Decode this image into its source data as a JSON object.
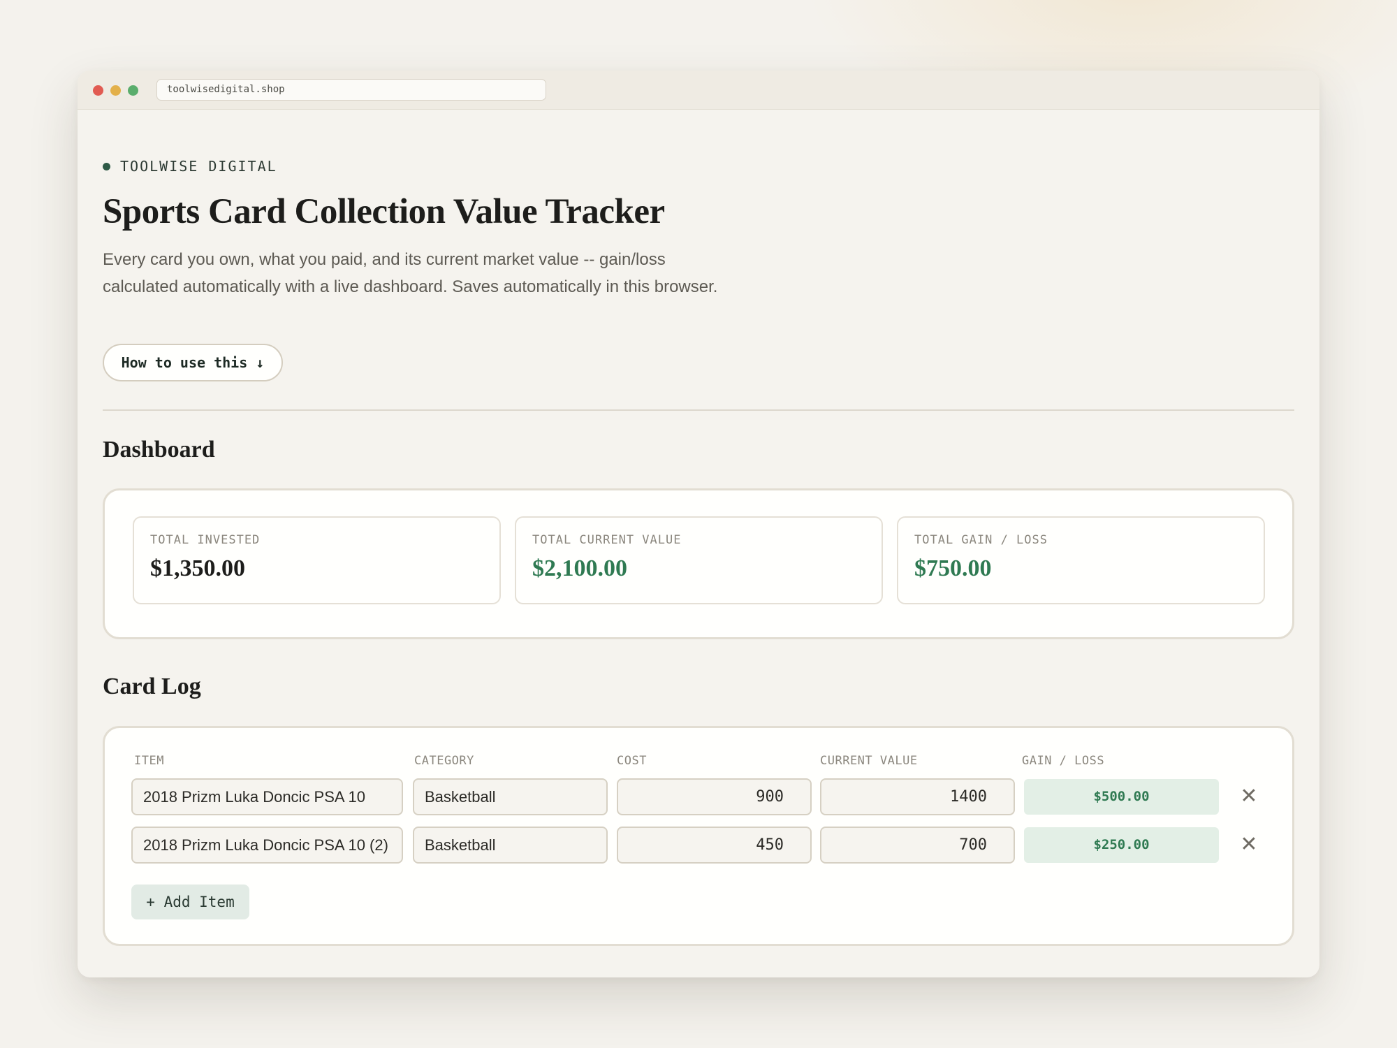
{
  "browser": {
    "url": "toolwisedigital.shop"
  },
  "header": {
    "brand": "TOOLWISE DIGITAL",
    "title": "Sports Card Collection Value Tracker",
    "description": "Every card you own, what you paid, and its current market value -- gain/loss calculated automatically with a live dashboard. Saves automatically in this browser.",
    "how_to_label": "How to use this ↓"
  },
  "dashboard": {
    "heading": "Dashboard",
    "stats": [
      {
        "label": "TOTAL INVESTED",
        "value": "$1,350.00",
        "color": "#1d1d1b"
      },
      {
        "label": "TOTAL CURRENT VALUE",
        "value": "$2,100.00",
        "color": "#2f7a52"
      },
      {
        "label": "TOTAL GAIN / LOSS",
        "value": "$750.00",
        "color": "#2f7a52"
      }
    ]
  },
  "card_log": {
    "heading": "Card Log",
    "columns": [
      "ITEM",
      "CATEGORY",
      "COST",
      "CURRENT VALUE",
      "GAIN / LOSS"
    ],
    "rows": [
      {
        "item": "2018 Prizm Luka Doncic PSA 10",
        "category": "Basketball",
        "cost": "900",
        "current_value": "1400",
        "gain_loss": "$500.00"
      },
      {
        "item": "2018 Prizm Luka Doncic PSA 10 (2)",
        "category": "Basketball",
        "cost": "450",
        "current_value": "700",
        "gain_loss": "$250.00"
      }
    ],
    "remove_icon": "close-icon",
    "remove_glyph": "✕",
    "add_label": "+ Add Item"
  },
  "colors": {
    "accent_green": "#2f7a52",
    "gain_bg": "#e3efe6",
    "page_bg": "#f4f2ed"
  }
}
